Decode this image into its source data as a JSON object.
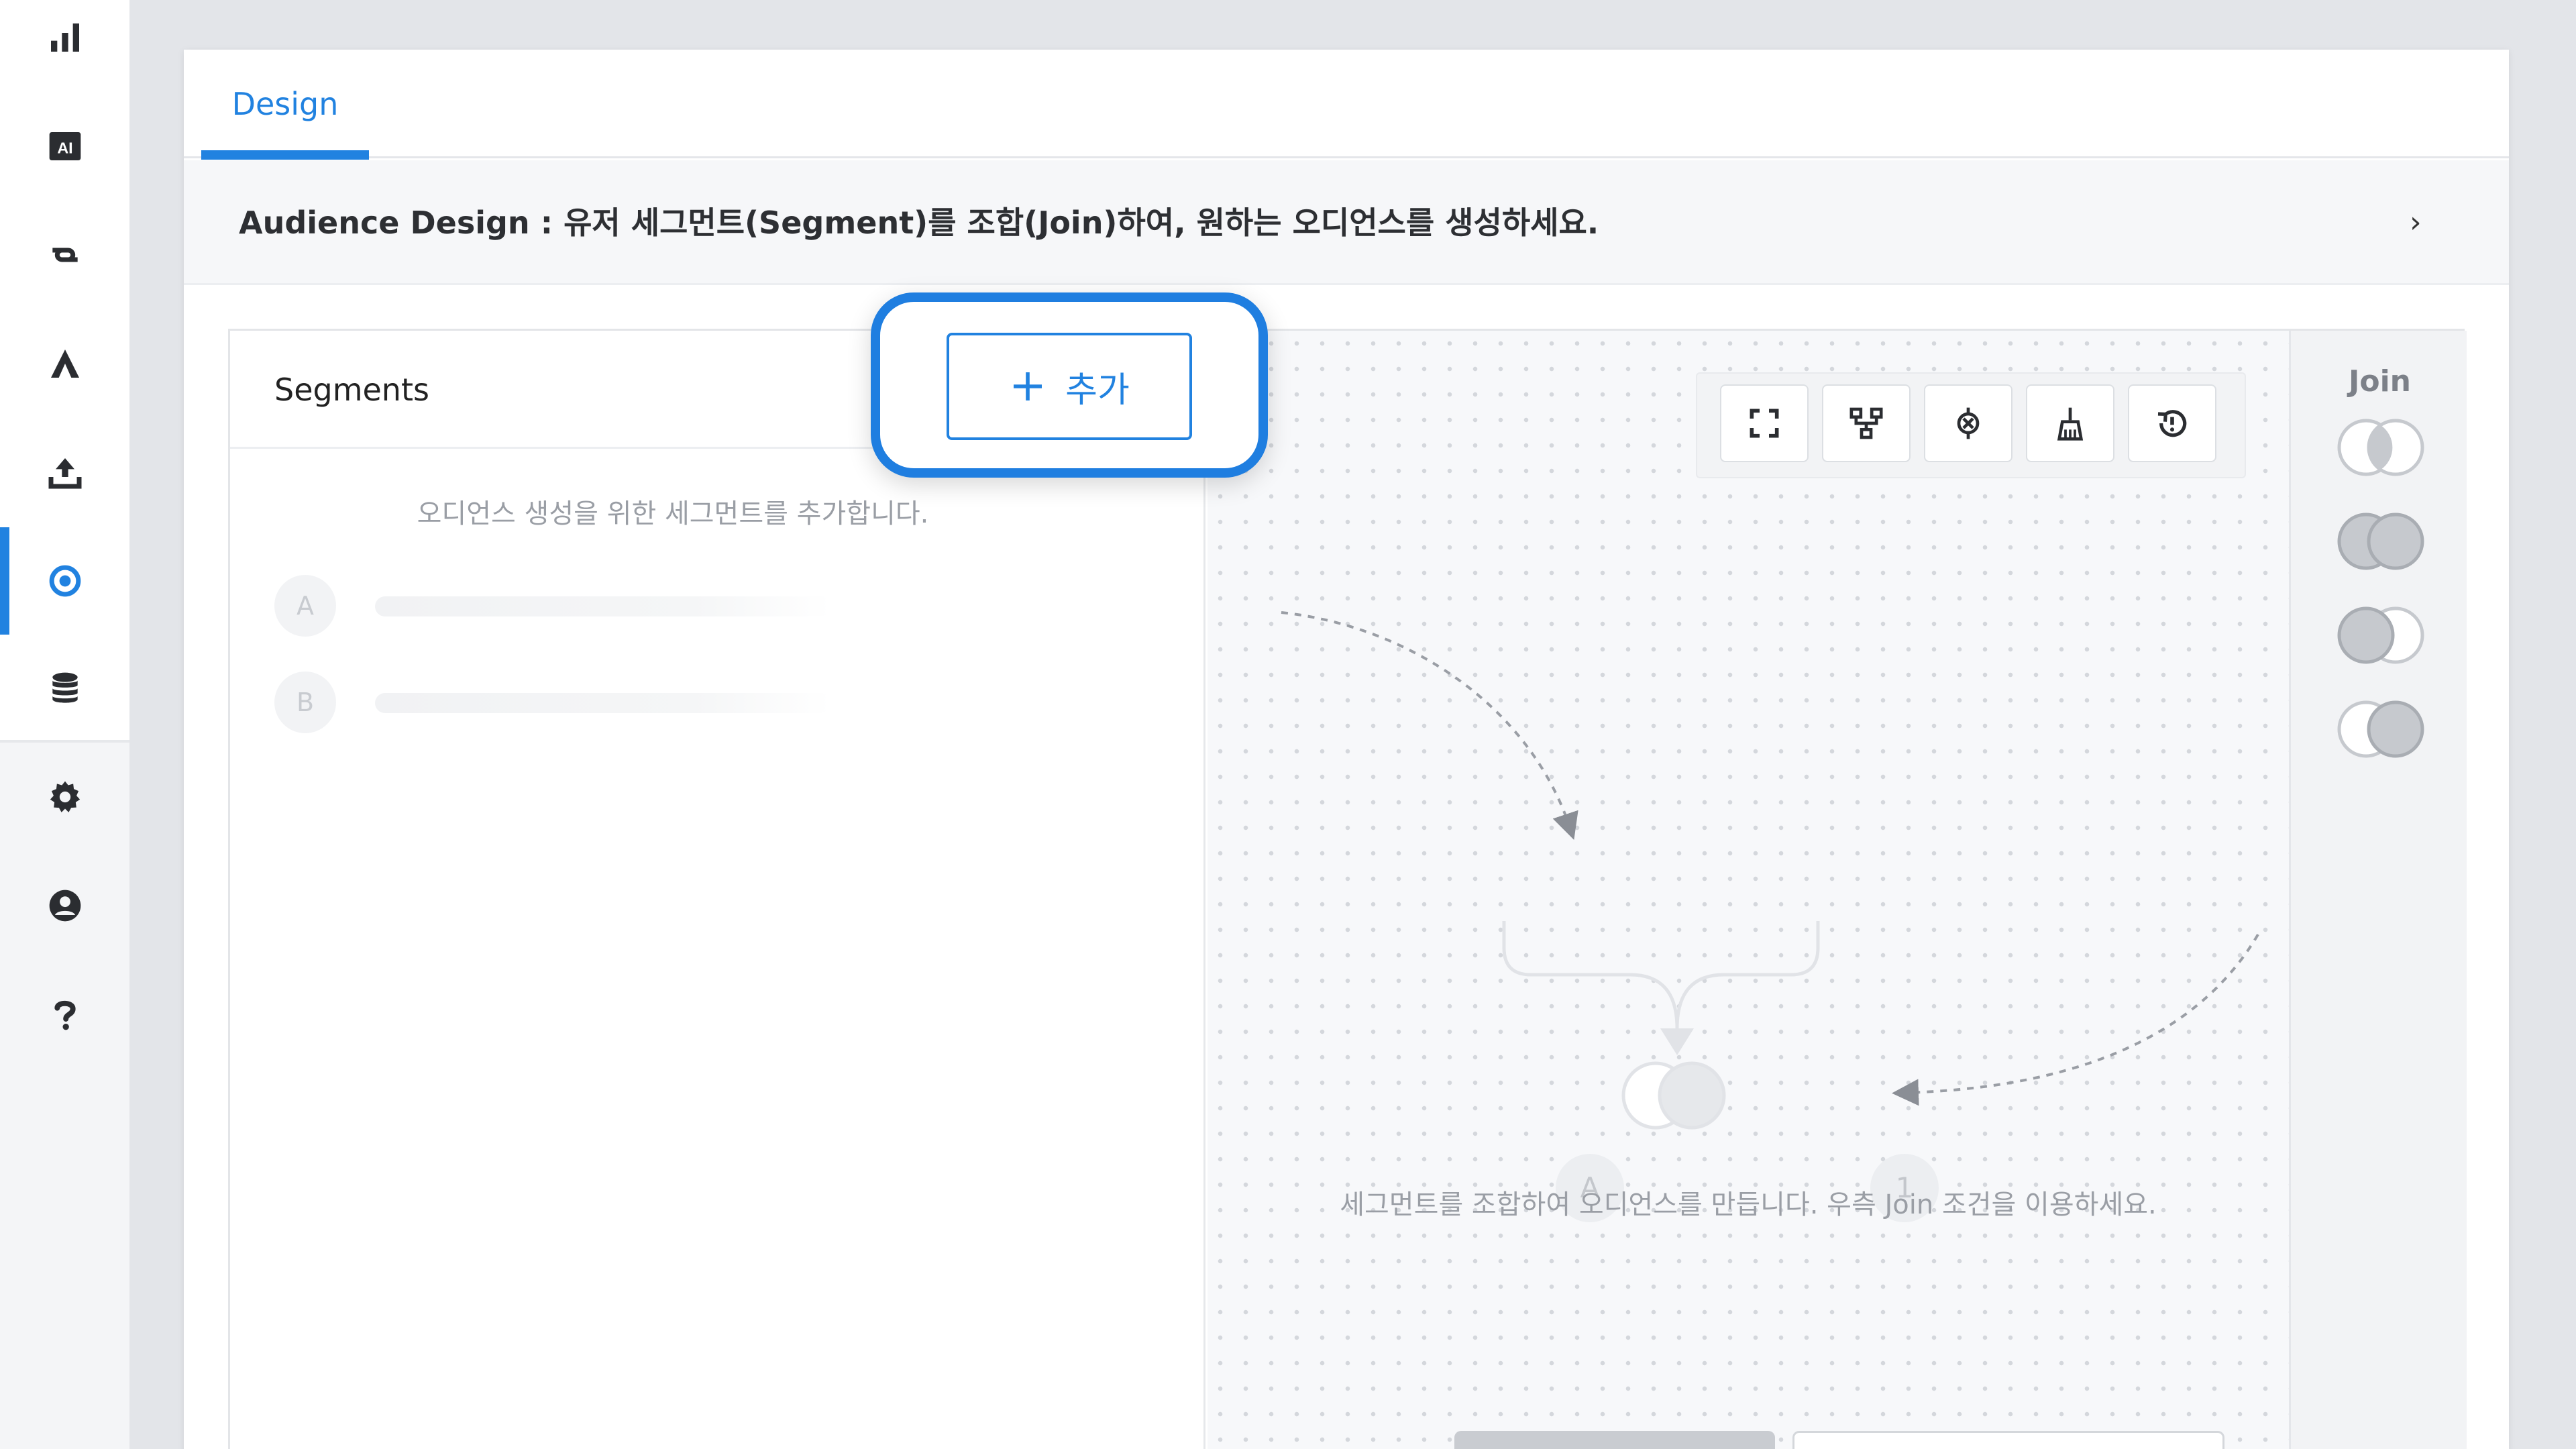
{
  "colors": {
    "accent": "#2182e0",
    "highlight": "#1f7ee0"
  },
  "sidebar": {
    "items": [
      {
        "name": "chart",
        "icon": "bar-chart-icon"
      },
      {
        "name": "ai",
        "icon": "ai-icon",
        "label": "AI"
      },
      {
        "name": "link",
        "icon": "chain-link-icon"
      },
      {
        "name": "arrow",
        "icon": "caret-up-icon"
      },
      {
        "name": "upload",
        "icon": "upload-icon"
      },
      {
        "name": "audience",
        "icon": "target-icon",
        "active": true
      },
      {
        "name": "database",
        "icon": "database-icon"
      },
      {
        "name": "settings",
        "icon": "gear-icon"
      },
      {
        "name": "account",
        "icon": "user-circle-icon"
      },
      {
        "name": "help",
        "icon": "question-mark-icon"
      }
    ]
  },
  "tabs": [
    {
      "label": "Design",
      "active": true
    }
  ],
  "info_bar": {
    "text": "Audience Design : 유저 세그먼트(Segment)를 조합(Join)하여, 원하는 오디언스를 생성하세요.",
    "chevron": "›"
  },
  "segments": {
    "title": "Segments",
    "add_label": "추가",
    "empty_text": "오디언스 생성을 위한 세그먼트를 추가합니다.",
    "placeholders": [
      {
        "label": "A"
      },
      {
        "label": "B"
      }
    ]
  },
  "canvas": {
    "toolbar": [
      "fullscreen-icon",
      "tree-layout-icon",
      "pin-icon",
      "broom-icon",
      "history-icon"
    ],
    "nodes": [
      {
        "label": "A"
      },
      {
        "label": "1"
      }
    ],
    "hint": "세그먼트를 조합하여 오디언스를 만듭니다. 우측 Join 조건을 이용하세요."
  },
  "join": {
    "title": "Join",
    "options": [
      "intersection-join-icon",
      "union-join-icon",
      "left-join-icon",
      "right-join-icon"
    ]
  }
}
